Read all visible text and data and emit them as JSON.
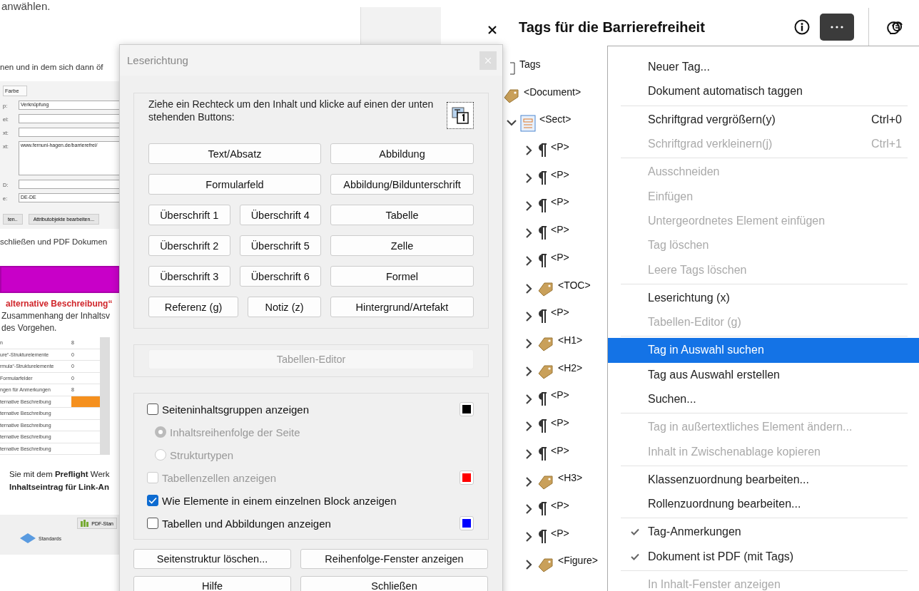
{
  "background_document": {
    "top_text": "anwählen.",
    "intro": "nen und in dem sich dann öf",
    "properties_panel": {
      "tab": "Farbe",
      "fields": [
        {
          "label": "p:",
          "value": "Verknüpfung",
          "kind": "line"
        },
        {
          "label": "el:",
          "kind": "line"
        },
        {
          "label": "xt:",
          "kind": "line"
        },
        {
          "label": "xt:",
          "value": "www.fernuni-hagen.de/barrierefrei/",
          "kind": "area"
        },
        {
          "label": "D:",
          "kind": "line"
        },
        {
          "label": "e:",
          "value": "DE-DE",
          "kind": "line"
        }
      ],
      "buttons": [
        "ten..",
        "Attributobjekte bearbeiten..."
      ]
    },
    "after_text": "schließen und PDF Dokumen",
    "red_heading": "alternative Beschreibung“",
    "paragraph_lines": [
      "Zusammenhang der Inhaltsv",
      "des Vorgehen."
    ],
    "report_rows": [
      {
        "label": "n",
        "value": "8",
        "flagged": false
      },
      {
        "label": "ure“-Strukturelemente",
        "value": "0",
        "flagged": false
      },
      {
        "label": "rmula“-Strukturelemente",
        "value": "0",
        "flagged": false
      },
      {
        "label": "Formularfelder",
        "value": "0",
        "flagged": false
      },
      {
        "label": "ngen für Anmerkungen",
        "value": "8",
        "flagged": false
      },
      {
        "label": "ternative Beschreibung",
        "flagged": true
      },
      {
        "label": "ternative Beschreibung",
        "flagged": false
      },
      {
        "label": "ternative Beschreibung",
        "flagged": false
      },
      {
        "label": "ternative Beschreibung",
        "flagged": false
      },
      {
        "label": "ternative Beschreibung",
        "flagged": false
      }
    ],
    "bottom_lines": [
      {
        "text": "Sie mit dem **Preflight** Werk",
        "bold": false
      },
      {
        "text": "Inhaltseintrag für Link-An",
        "bold": true
      }
    ],
    "toolbar": {
      "button": "PDF-Stan",
      "item": "Standards"
    }
  },
  "dialog": {
    "title": "Leserichtung",
    "instruction": "Ziehe ein Rechteck um den Inhalt und klicke auf einen der unten stehenden Buttons:",
    "tag_rows": [
      {
        "left": [
          "Text/Absatz"
        ],
        "right": "Abbildung"
      },
      {
        "left": [
          "Formularfeld"
        ],
        "right": "Abbildung/Bildunterschrift"
      },
      {
        "left": [
          "Überschrift 1",
          "Überschrift 4"
        ],
        "right": "Tabelle"
      },
      {
        "left": [
          "Überschrift 2",
          "Überschrift 5"
        ],
        "right": "Zelle"
      },
      {
        "left": [
          "Überschrift 3",
          "Überschrift 6"
        ],
        "right": "Formel"
      },
      {
        "left": [
          "Referenz (g)",
          "Notiz (z)"
        ],
        "right": "Hintergrund/Artefakt"
      }
    ],
    "table_editor": {
      "label": "Tabellen-Editor",
      "disabled": true
    },
    "options": [
      {
        "kind": "checkbox",
        "label": "Seiteninhaltsgruppen anzeigen",
        "checked": false,
        "disabled": false,
        "color": "#000000"
      },
      {
        "kind": "radio",
        "label": "Inhaltsreihenfolge der Seite",
        "selected": true,
        "disabled": true
      },
      {
        "kind": "radio",
        "label": "Strukturtypen",
        "selected": false,
        "disabled": true
      },
      {
        "kind": "checkbox",
        "label": "Tabellenzellen anzeigen",
        "checked": false,
        "disabled": true,
        "color": "#ff0000"
      },
      {
        "kind": "checkbox",
        "label": "Wie Elemente in einem einzelnen Block anzeigen",
        "checked": true,
        "disabled": false
      },
      {
        "kind": "checkbox",
        "label": "Tabellen und Abbildungen anzeigen",
        "checked": false,
        "disabled": false,
        "color": "#0000ff"
      }
    ],
    "footer_buttons": [
      "Seitenstruktur löschen...",
      "Reihenfolge-Fenster anzeigen",
      "Hilfe",
      "Schließen"
    ]
  },
  "panel": {
    "title": "Tags für die Barrierefreiheit",
    "tree": [
      {
        "label": "Tags",
        "kind": "root",
        "children": [
          {
            "label": "<Document>",
            "kind": "tag",
            "children": [
              {
                "label": "<Sect>",
                "kind": "section",
                "expanded": true,
                "children": [
                  {
                    "label": "<P>",
                    "kind": "para",
                    "expanded": false
                  },
                  {
                    "label": "<P>",
                    "kind": "para",
                    "expanded": false
                  },
                  {
                    "label": "<P>",
                    "kind": "para",
                    "expanded": false
                  },
                  {
                    "label": "<P>",
                    "kind": "para",
                    "expanded": false
                  },
                  {
                    "label": "<P>",
                    "kind": "para",
                    "expanded": false
                  },
                  {
                    "label": "<TOC>",
                    "kind": "tag",
                    "expanded": false
                  },
                  {
                    "label": "<P>",
                    "kind": "para",
                    "expanded": false
                  },
                  {
                    "label": "<H1>",
                    "kind": "tag",
                    "expanded": false
                  },
                  {
                    "label": "<H2>",
                    "kind": "tag",
                    "expanded": false
                  },
                  {
                    "label": "<P>",
                    "kind": "para",
                    "expanded": false
                  },
                  {
                    "label": "<P>",
                    "kind": "para",
                    "expanded": false
                  },
                  {
                    "label": "<P>",
                    "kind": "para",
                    "expanded": false
                  },
                  {
                    "label": "<H3>",
                    "kind": "tag",
                    "expanded": false
                  },
                  {
                    "label": "<P>",
                    "kind": "para",
                    "expanded": false
                  },
                  {
                    "label": "<P>",
                    "kind": "para",
                    "expanded": false
                  },
                  {
                    "label": "<Figure>",
                    "kind": "tag",
                    "expanded": false
                  }
                ]
              }
            ]
          }
        ]
      }
    ]
  },
  "menu": [
    {
      "kind": "item",
      "label": "Neuer Tag...",
      "disabled": false,
      "selected": false
    },
    {
      "kind": "item",
      "label": "Dokument automatisch taggen",
      "disabled": false,
      "selected": false
    },
    {
      "kind": "separator"
    },
    {
      "kind": "item",
      "label": "Schriftgrad vergrößern(y)",
      "shortcut": "Ctrl+0",
      "disabled": false,
      "selected": false
    },
    {
      "kind": "item",
      "label": "Schriftgrad verkleinern(j)",
      "shortcut": "Ctrl+1",
      "disabled": true,
      "selected": false
    },
    {
      "kind": "separator"
    },
    {
      "kind": "item",
      "label": "Ausschneiden",
      "disabled": true,
      "selected": false
    },
    {
      "kind": "item",
      "label": "Einfügen",
      "disabled": true,
      "selected": false
    },
    {
      "kind": "item",
      "label": "Untergeordnetes Element einfügen",
      "disabled": true,
      "selected": false
    },
    {
      "kind": "item",
      "label": "Tag löschen",
      "disabled": true,
      "selected": false
    },
    {
      "kind": "item",
      "label": "Leere Tags löschen",
      "disabled": true,
      "selected": false
    },
    {
      "kind": "separator"
    },
    {
      "kind": "item",
      "label": "Leserichtung (x)",
      "disabled": false,
      "selected": false
    },
    {
      "kind": "item",
      "label": "Tabellen-Editor (g)",
      "disabled": true,
      "selected": false
    },
    {
      "kind": "separator"
    },
    {
      "kind": "item",
      "label": "Tag in Auswahl suchen",
      "disabled": false,
      "selected": true
    },
    {
      "kind": "item",
      "label": "Tag aus Auswahl erstellen",
      "disabled": false,
      "selected": false
    },
    {
      "kind": "item",
      "label": "Suchen...",
      "disabled": false,
      "selected": false
    },
    {
      "kind": "separator"
    },
    {
      "kind": "item",
      "label": "Tag in außertextliches Element ändern...",
      "disabled": true,
      "selected": false
    },
    {
      "kind": "item",
      "label": "Inhalt in Zwischenablage kopieren",
      "disabled": true,
      "selected": false
    },
    {
      "kind": "separator"
    },
    {
      "kind": "item",
      "label": "Klassenzuordnung bearbeiten...",
      "disabled": false,
      "selected": false
    },
    {
      "kind": "item",
      "label": "Rollenzuordnung bearbeiten...",
      "disabled": false,
      "selected": false
    },
    {
      "kind": "separator"
    },
    {
      "kind": "item",
      "label": "Tag-Anmerkungen",
      "disabled": false,
      "selected": false,
      "checked": true
    },
    {
      "kind": "item",
      "label": "Dokument ist PDF (mit Tags)",
      "disabled": false,
      "selected": false,
      "checked": true
    },
    {
      "kind": "separator"
    },
    {
      "kind": "item",
      "label": "In Inhalt-Fenster anzeigen",
      "disabled": true,
      "selected": false
    }
  ]
}
